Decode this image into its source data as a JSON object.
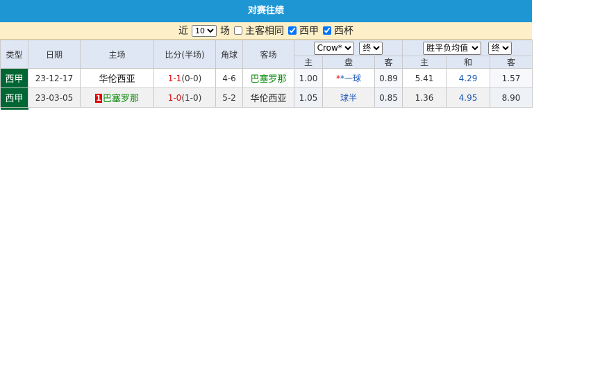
{
  "title": "对赛往绩",
  "filter": {
    "recent_label": "近",
    "recent_value": "10",
    "field_label": "场",
    "same_label": "主客相同",
    "same_checked": false,
    "league1_label": "西甲",
    "league1_checked": true,
    "league2_label": "西杯",
    "league2_checked": true
  },
  "headers": {
    "type": "类型",
    "date": "日期",
    "home": "主场",
    "score": "比分(半场)",
    "corner": "角球",
    "away": "客场",
    "asian_company": "Crow*",
    "asian_timing": "终",
    "euro_company": "胜平负均值",
    "euro_timing": "终",
    "sub_home": "主",
    "sub_pan": "盘",
    "sub_away": "客",
    "sub_home2": "主",
    "sub_draw": "和",
    "sub_away2": "客"
  },
  "rows": [
    {
      "type": "西甲",
      "date": "23-12-17",
      "home": "华伦西亚",
      "score_ft": "1-1",
      "score_ht": "(0-0)",
      "corner": "4-6",
      "away": "巴塞罗那",
      "asia_home": "1.00",
      "asia_line": "*一球",
      "asia_away": "0.89",
      "euro_home": "5.41",
      "euro_draw": "4.29",
      "euro_away": "1.57"
    },
    {
      "type": "西甲",
      "date": "23-03-05",
      "home_flag": "1",
      "home": "巴塞罗那",
      "score_ft": "1-0",
      "score_ht": "(1-0)",
      "corner": "5-2",
      "away": "华伦西亚",
      "asia_home": "1.05",
      "asia_line": "球半",
      "asia_away": "0.85",
      "euro_home": "1.36",
      "euro_draw": "4.95",
      "euro_away": "8.90"
    }
  ],
  "colors": {
    "title_bg": "#1e96d4",
    "filter_bg": "#fdefc8",
    "header_bg": "#dfe7f4",
    "type_bg": "#006633",
    "score_red": "#e00000",
    "handicap_blue": "#1a56b5",
    "team_green": "#0d8a0d"
  }
}
